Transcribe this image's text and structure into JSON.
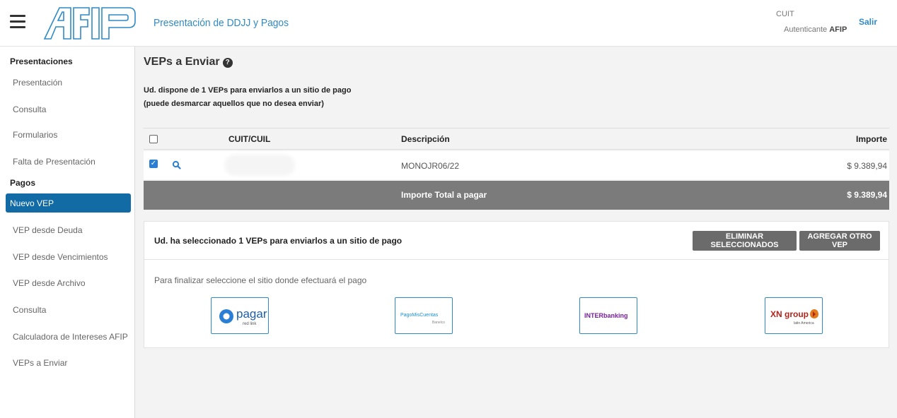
{
  "header": {
    "title": "Presentación de DDJJ y Pagos",
    "cuit_label": "CUIT",
    "auth_prefix": "Autenticante",
    "auth_entity": "AFIP",
    "logout": "Salir"
  },
  "sidebar": {
    "section_presentaciones": "Presentaciones",
    "presentaciones": [
      {
        "label": "Presentación"
      },
      {
        "label": "Consulta"
      },
      {
        "label": "Formularios"
      },
      {
        "label": "Falta de Presentación"
      }
    ],
    "section_pagos": "Pagos",
    "pagos": [
      {
        "label": "Nuevo VEP"
      },
      {
        "label": "VEP desde Deuda"
      },
      {
        "label": "VEP desde Vencimientos"
      },
      {
        "label": "VEP desde Archivo"
      },
      {
        "label": "Consulta"
      },
      {
        "label": "Calculadora de Intereses AFIP"
      },
      {
        "label": "VEPs a Enviar"
      }
    ]
  },
  "main": {
    "title": "VEPs a Enviar",
    "intro_line1": "Ud. dispone de 1 VEPs para enviarlos a un sitio de pago",
    "intro_line2": "(puede desmarcar aquellos que no desea enviar)",
    "table": {
      "headers": {
        "cuit": "CUIT/CUIL",
        "descripcion": "Descripción",
        "importe": "Importe"
      },
      "rows": [
        {
          "checked": true,
          "cuit": "",
          "descripcion": "MONOJR06/22",
          "importe": "$ 9.389,94"
        }
      ],
      "total_label": "Importe Total a pagar",
      "total_value": "$ 9.389,94"
    },
    "selection": {
      "message": "Ud. ha seleccionado 1 VEPs para enviarlos a un sitio de pago",
      "btn_delete": "ELIMINAR SELECCIONADOS",
      "btn_add": "AGREGAR OTRO VEP",
      "hint": "Para finalizar seleccione el sitio donde efectuará el pago"
    },
    "payment_sites": [
      {
        "name": "pagar",
        "sub": "red link"
      },
      {
        "name": "PagoMisCuentas",
        "sub": "Banelco"
      },
      {
        "name": "INTERbanking"
      },
      {
        "name": "XN group",
        "sub": "latin America"
      }
    ]
  },
  "colors": {
    "accent": "#2f8ac6",
    "active_nav": "#136ba6",
    "total_bar": "#7b7b7b",
    "button": "#6b6b6b"
  }
}
